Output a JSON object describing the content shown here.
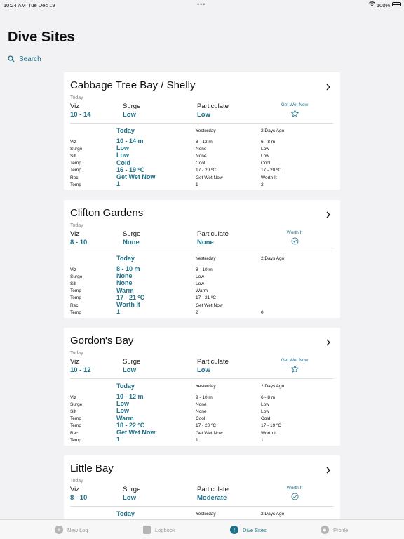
{
  "status_bar": {
    "time": "10:24 AM",
    "date": "Tue Dec 19",
    "battery": "100%"
  },
  "page_title": "Dive Sites",
  "search": {
    "label": "Search"
  },
  "cards": [
    {
      "title": "Cabbage Tree Bay / Shelly",
      "today_label": "Today",
      "summary": {
        "viz_label": "Viz",
        "viz": "10 - 14",
        "surge_label": "Surge",
        "surge": "Low",
        "particulate_label": "Particulate",
        "particulate": "Low"
      },
      "rec": {
        "text": "Get Wet Now",
        "icon": "star-icon"
      },
      "table_headers": [
        "Today",
        "Yesterday",
        "2 Days Ago"
      ],
      "rows": [
        {
          "label": "Viz",
          "today": "10 - 14 m",
          "yesterday": "8 - 12 m",
          "two_days": "6 - 8 m"
        },
        {
          "label": "Surge",
          "today": "Low",
          "yesterday": "None",
          "two_days": "Low"
        },
        {
          "label": "Silt",
          "today": "Low",
          "yesterday": "None",
          "two_days": "Low"
        },
        {
          "label": "Temp",
          "today": "Cold",
          "yesterday": "Cool",
          "two_days": "Cool"
        },
        {
          "label": "Temp",
          "today": "16 - 19 ºC",
          "yesterday": "17 - 20 ºC",
          "two_days": "17 - 20 ºC"
        },
        {
          "label": "Rec",
          "today": "Get Wet Now",
          "yesterday": "Get Wet Now",
          "two_days": "Worth It"
        },
        {
          "label": "Temp",
          "today": "1",
          "yesterday": "1",
          "two_days": "2"
        }
      ]
    },
    {
      "title": "Clifton Gardens",
      "today_label": "Today",
      "summary": {
        "viz_label": "Viz",
        "viz": "8 - 10",
        "surge_label": "Surge",
        "surge": "None",
        "particulate_label": "Particulate",
        "particulate": "None"
      },
      "rec": {
        "text": "Worth It",
        "icon": "check-circle-icon"
      },
      "table_headers": [
        "Today",
        "Yesterday",
        "2 Days Ago"
      ],
      "rows": [
        {
          "label": "Viz",
          "today": "8 - 10 m",
          "yesterday": "8 - 10 m",
          "two_days": ""
        },
        {
          "label": "Surge",
          "today": "None",
          "yesterday": "Low",
          "two_days": ""
        },
        {
          "label": "Silt",
          "today": "None",
          "yesterday": "Low",
          "two_days": ""
        },
        {
          "label": "Temp",
          "today": "Warm",
          "yesterday": "Warm",
          "two_days": ""
        },
        {
          "label": "Temp",
          "today": "17 - 21 ºC",
          "yesterday": "17 - 21 ºC",
          "two_days": ""
        },
        {
          "label": "Rec",
          "today": "Worth It",
          "yesterday": "Get Wet Now",
          "two_days": ""
        },
        {
          "label": "Temp",
          "today": "1",
          "yesterday": "2",
          "two_days": "0"
        }
      ]
    },
    {
      "title": "Gordon's Bay",
      "today_label": "Today",
      "summary": {
        "viz_label": "Viz",
        "viz": "10 - 12",
        "surge_label": "Surge",
        "surge": "Low",
        "particulate_label": "Particulate",
        "particulate": "Low"
      },
      "rec": {
        "text": "Get Wet Now",
        "icon": "star-icon"
      },
      "table_headers": [
        "Today",
        "Yesterday",
        "2 Days Ago"
      ],
      "rows": [
        {
          "label": "Viz",
          "today": "10 - 12 m",
          "yesterday": "9 - 10 m",
          "two_days": "6 - 8 m"
        },
        {
          "label": "Surge",
          "today": "Low",
          "yesterday": "None",
          "two_days": "Low"
        },
        {
          "label": "Silt",
          "today": "Low",
          "yesterday": "None",
          "two_days": "Low"
        },
        {
          "label": "Temp",
          "today": "Warm",
          "yesterday": "Cool",
          "two_days": "Cold"
        },
        {
          "label": "Temp",
          "today": "18 - 22 ºC",
          "yesterday": "17 - 20 ºC",
          "two_days": "17 - 19 ºC"
        },
        {
          "label": "Rec",
          "today": "Get Wet Now",
          "yesterday": "Get Wet Now",
          "two_days": "Worth It"
        },
        {
          "label": "Temp",
          "today": "1",
          "yesterday": "1",
          "two_days": "1"
        }
      ]
    },
    {
      "title": "Little Bay",
      "today_label": "Today",
      "summary": {
        "viz_label": "Viz",
        "viz": "8 - 10",
        "surge_label": "Surge",
        "surge": "Low",
        "particulate_label": "Particulate",
        "particulate": "Moderate"
      },
      "rec": {
        "text": "Worth It",
        "icon": "check-circle-icon"
      },
      "table_headers": [
        "Today",
        "Yesterday",
        "2 Days Ago"
      ],
      "rows": []
    }
  ],
  "tab_bar": [
    {
      "label": "New Log",
      "icon": "plus-circle-icon"
    },
    {
      "label": "Logbook",
      "icon": "book-icon"
    },
    {
      "label": "Dive Sites",
      "icon": "diver-icon",
      "active": true
    },
    {
      "label": "Profile",
      "icon": "person-icon"
    }
  ],
  "colors": {
    "accent": "#1f7189",
    "background": "#f2f2f4",
    "card": "#ffffff"
  }
}
